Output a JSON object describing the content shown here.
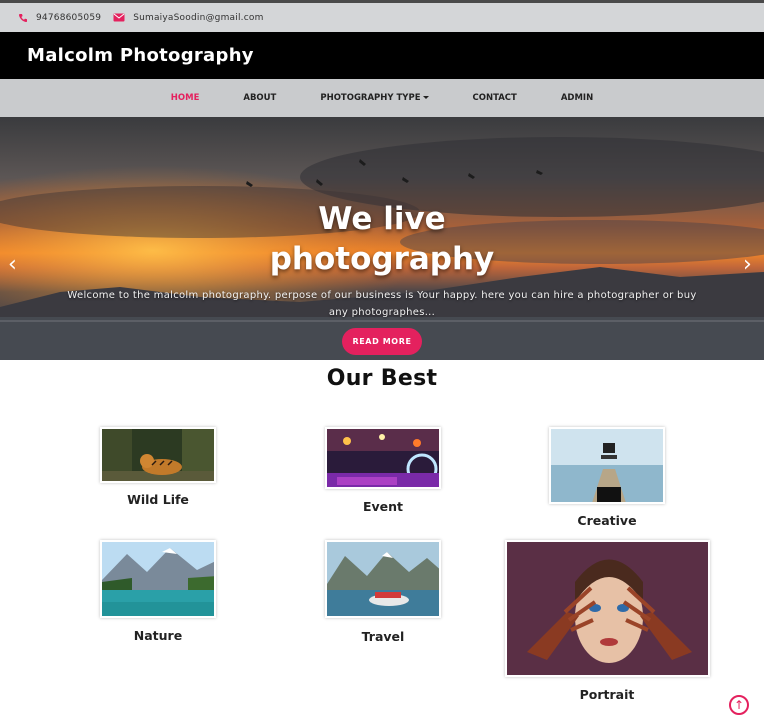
{
  "contact": {
    "phone": "94768605059",
    "email": "SumaiyaSoodin@gmail.com"
  },
  "brand": "Malcolm Photography",
  "nav": {
    "items": [
      {
        "label": "HOME",
        "active": true
      },
      {
        "label": "ABOUT",
        "active": false
      },
      {
        "label": "PHOTOGRAPHY TYPE",
        "active": false,
        "dropdown": true
      },
      {
        "label": "CONTACT",
        "active": false
      },
      {
        "label": "ADMIN",
        "active": false
      }
    ]
  },
  "hero": {
    "title_line1": "We live",
    "title_line2": "photography",
    "text": "Welcome to the malcolm photography. perpose of our business is Your happy. here you can hire a photographer or buy any photographes...",
    "button": "READ MORE",
    "prev_icon": "chevron-left-icon",
    "next_icon": "chevron-right-icon"
  },
  "section": {
    "title": "Our Best",
    "cards": [
      {
        "label": "Wild Life"
      },
      {
        "label": "Event"
      },
      {
        "label": "Creative"
      },
      {
        "label": "Nature"
      },
      {
        "label": "Travel"
      },
      {
        "label": "Portrait"
      }
    ]
  },
  "colors": {
    "accent": "#e4215e",
    "brandbar": "#000000",
    "navbar": "#c9cbcd",
    "topbar": "#d4d6d8"
  },
  "icons": {
    "phone": "phone-icon",
    "email": "envelope-icon",
    "scroll_top": "arrow-up-circle-icon"
  }
}
